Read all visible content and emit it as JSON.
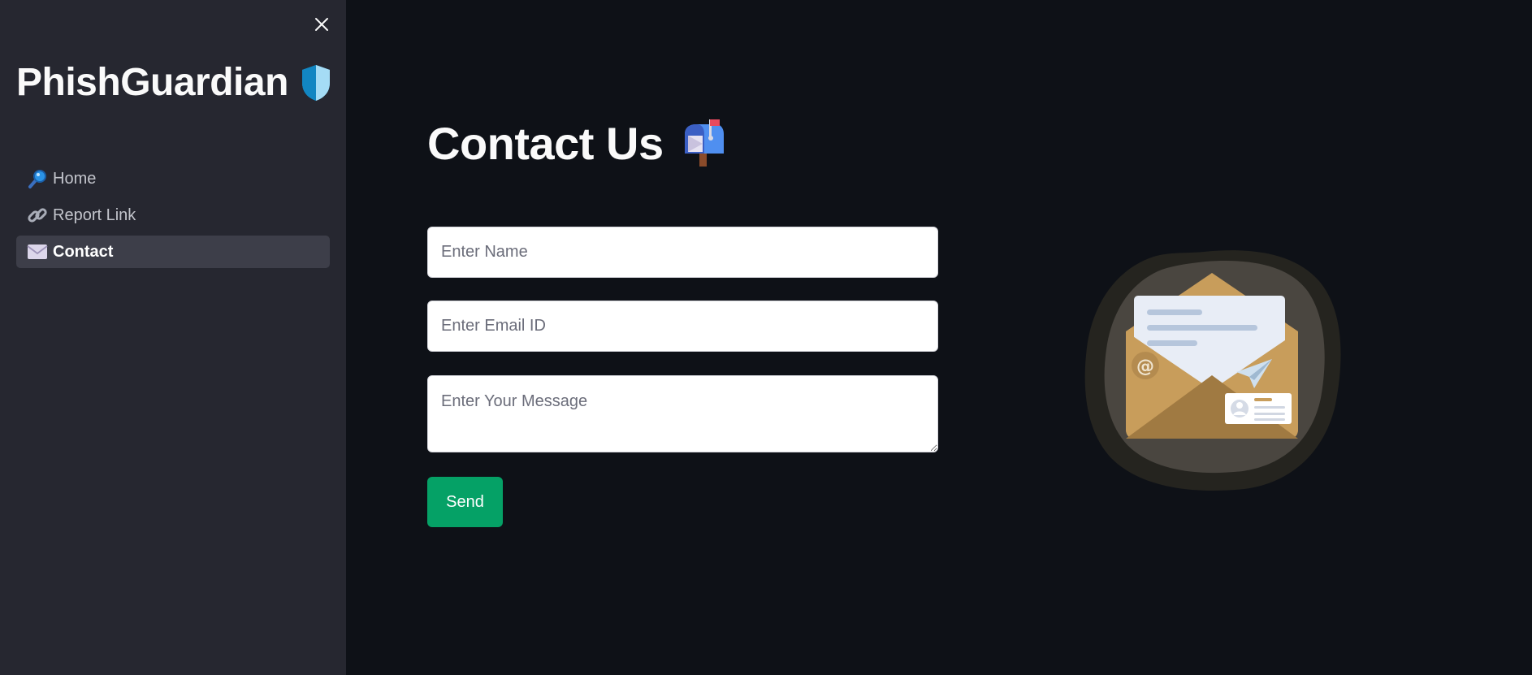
{
  "sidebar": {
    "brand": "PhishGuardian",
    "close_icon": "close-icon",
    "items": [
      {
        "label": "Home",
        "icon": "magnifier-icon",
        "active": false
      },
      {
        "label": "Report Link",
        "icon": "link-icon",
        "active": false
      },
      {
        "label": "Contact",
        "icon": "envelope-icon",
        "active": true
      }
    ]
  },
  "main": {
    "title": "Contact Us",
    "title_icon": "mailbox-icon",
    "form": {
      "name_placeholder": "Enter Name",
      "email_placeholder": "Enter Email ID",
      "message_placeholder": "Enter Your Message",
      "send_label": "Send"
    },
    "illustration": "open-envelope-illustration"
  },
  "colors": {
    "background": "#0e1117",
    "sidebar": "#262730",
    "active_item": "#3d3e49",
    "send_button": "#05a166",
    "text": "#fafafa"
  }
}
